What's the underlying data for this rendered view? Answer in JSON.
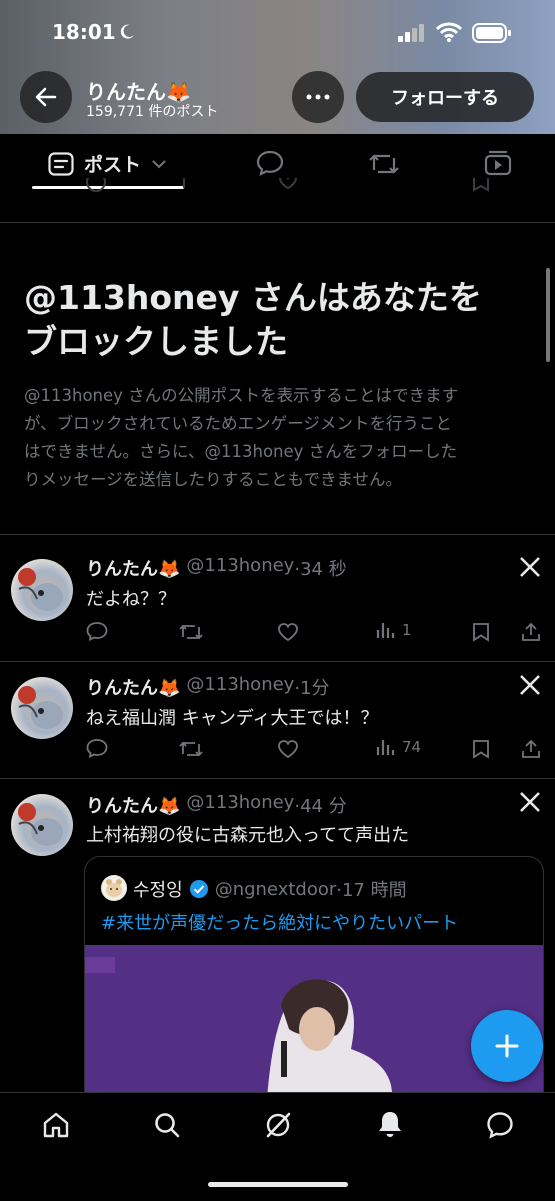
{
  "status": {
    "time": "18:01"
  },
  "header": {
    "name": "りんたん🦊",
    "post_count": "159,771 件のポスト",
    "follow_label": "フォローする"
  },
  "tabs": {
    "posts_label": "ポスト"
  },
  "block": {
    "title_line1": "@113honey さんはあなたを",
    "title_line2": "ブロックしました",
    "desc_lines": [
      "@113honey さんの公開ポストを表示することはできます",
      "が、ブロックされているためエンゲージメントを行うこと",
      "はできません。さらに、@113honey さんをフォローした",
      "りメッセージを送信したりすることもできません。"
    ]
  },
  "tweets": [
    {
      "name": "りんたん🦊",
      "handle": "@113honey",
      "time": "·34 秒",
      "text": "だよね？？",
      "views": "1"
    },
    {
      "name": "りんたん🦊",
      "handle": "@113honey",
      "time": "·1分",
      "text": "ねえ福山潤 キャンディ大王では！？",
      "views": "74"
    },
    {
      "name": "りんたん🦊",
      "handle": "@113honey",
      "time": "·44 分",
      "text": "上村祐翔の役に古森元也入ってて声出た",
      "views": ""
    }
  ],
  "quote": {
    "name": "수정잉",
    "handle": "@ngnextdoor",
    "time": "·17 時間",
    "text": "#来世が声優だったら絶対にやりたいパート"
  },
  "colors": {
    "accent": "#1d9bf0",
    "muted": "#71767b",
    "text": "#e7e9ea",
    "bg": "#000000"
  }
}
